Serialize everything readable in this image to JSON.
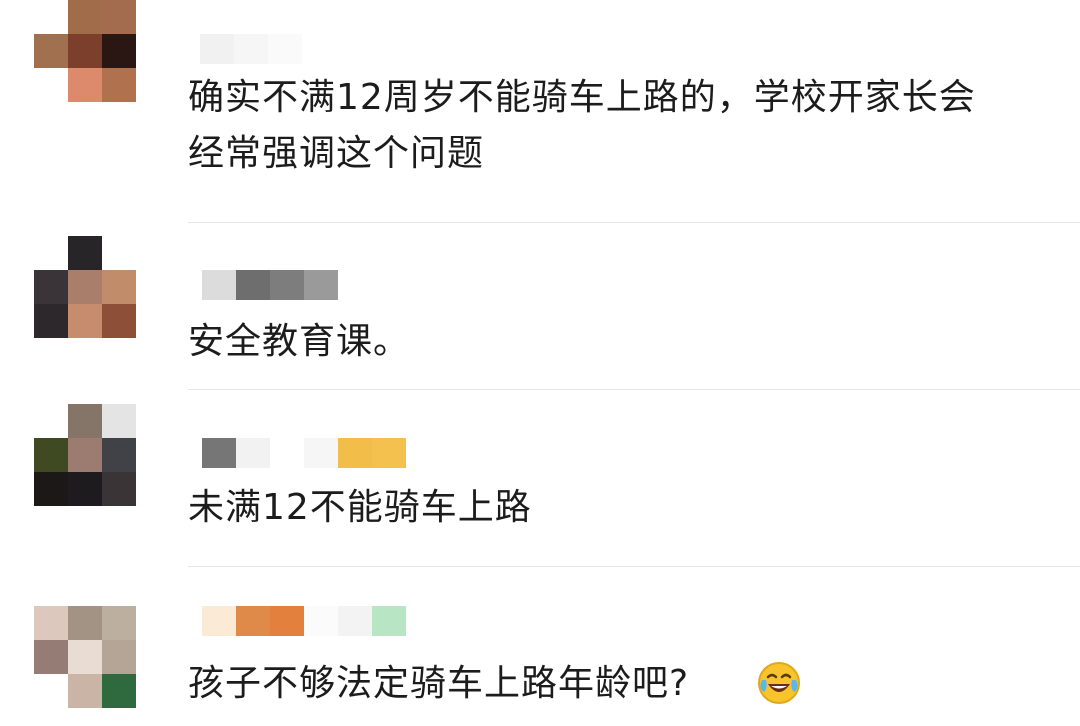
{
  "comments": [
    {
      "avatar": [
        "#ffffff",
        "#a06c4a",
        "#a36c4e",
        "#a0704f",
        "#7c3f2b",
        "#2a1612",
        "#ffffff",
        "#dd8a6c",
        "#b0714f"
      ],
      "name_blocks": [
        "#f1f1f1",
        "#f6f6f6",
        "#fafafa"
      ],
      "lines": [
        "确实不满12周岁不能骑车上路的，学校开家长会",
        "经常强调这个问题"
      ]
    },
    {
      "avatar": [
        "#ffffff",
        "#272528",
        "#ffffff",
        "#3a3338",
        "#a97e6a",
        "#c08c6a",
        "#2d282c",
        "#c58c6e",
        "#8e4f38"
      ],
      "name_blocks": [
        "#dcdcdc",
        "#6e6e6e",
        "#7d7d7d",
        "#9a9a9a"
      ],
      "lines": [
        "安全教育课。"
      ]
    },
    {
      "avatar": [
        "#ffffff",
        "#857568",
        "#e4e4e4",
        "#3f4a23",
        "#9c7c71",
        "#404247",
        "#1c1818",
        "#1e1b1f",
        "#3a3436"
      ],
      "name_blocks": [
        "#767676",
        "#f2f2f2",
        "#ffffff",
        "#f6f6f6",
        "#f3bd4a",
        "#f4c04e"
      ],
      "lines": [
        "未满12不能骑车上路"
      ]
    },
    {
      "avatar": [
        "#dcc8bd",
        "#a39385",
        "#bdaf9f",
        "#957c74",
        "#e8dcd3",
        "#b4a596",
        "#ffffff",
        "#c9b4a6",
        "#2e6a3d"
      ],
      "name_blocks": [
        "#fbebd6",
        "#e08a4a",
        "#e4803e",
        "#fbfbfb",
        "#f3f3f3",
        "#b8e6c4"
      ],
      "lines": [
        "孩子不够法定骑车上路年龄吧?"
      ],
      "emoji": "crying-laughing-emoji"
    }
  ]
}
